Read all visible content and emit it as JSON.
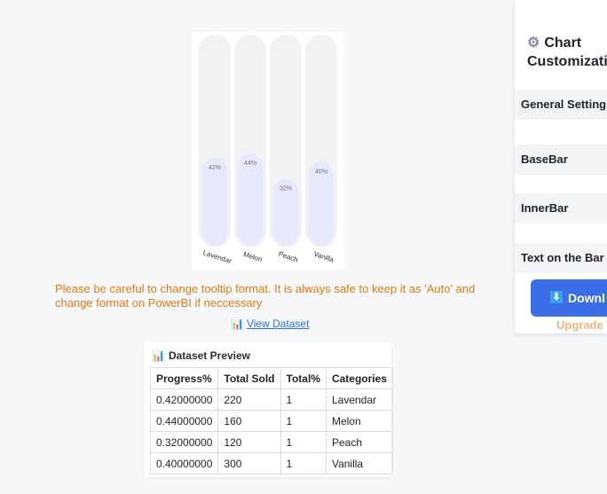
{
  "chart_data": {
    "type": "bar",
    "categories": [
      "Lavendar",
      "Melon",
      "Peach",
      "Vanilla"
    ],
    "values": [
      0.42,
      0.44,
      0.32,
      0.4
    ],
    "value_labels": [
      "42%",
      "44%",
      "32%",
      "40%"
    ],
    "ylim": [
      0,
      1
    ],
    "colors": {
      "base_bar": "#f2f2f2",
      "inner_bar": "#e6e9fb",
      "inner_stroke": "#f0f1fa"
    }
  },
  "warning_text": "Please be careful to change tooltip format. It is always safe to keep it as 'Auto' and change format on PowerBI if neccessary",
  "view_dataset": {
    "icon": "bar-chart-icon",
    "label": "View Dataset"
  },
  "dataset_preview": {
    "icon": "bar-chart-icon",
    "title": "Dataset Preview",
    "columns": [
      "Progress%",
      "Total Sold",
      "Total%",
      "Categories"
    ],
    "rows": [
      [
        "0.42000000",
        "220",
        "1",
        "Lavendar"
      ],
      [
        "0.44000000",
        "160",
        "1",
        "Melon"
      ],
      [
        "0.32000000",
        "120",
        "1",
        "Peach"
      ],
      [
        "0.40000000",
        "300",
        "1",
        "Vanilla"
      ]
    ]
  },
  "side_panel": {
    "title_line1": "Chart",
    "title_line2": "Customizati",
    "gear_icon": "gear-icon",
    "sections": [
      "General Setting",
      "BaseBar",
      "InnerBar",
      "Text on the Bar"
    ],
    "download_label": "Downl",
    "upgrade_label": "Upgrade",
    "accent": "#3b6de6"
  }
}
